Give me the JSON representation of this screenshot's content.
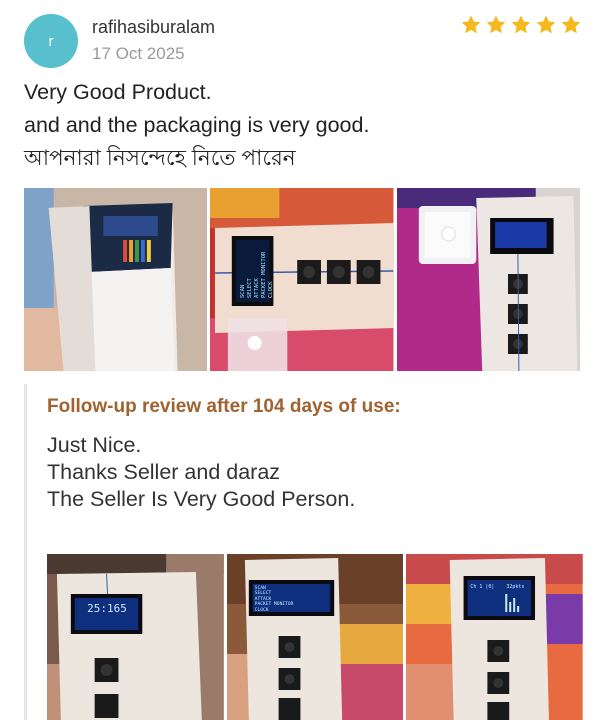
{
  "review": {
    "avatar_letter": "r",
    "username": "rafihasiburalam",
    "date": "17 Oct 2025",
    "rating": 5,
    "star_color": "#f5b91e",
    "text_lines": [
      "Very Good Product.",
      "and and the packaging is very good.",
      "আপনারা নিসন্দেহে নিতে পারেন"
    ],
    "photos": [
      "product-photo-1",
      "product-photo-2",
      "product-photo-3"
    ]
  },
  "followup": {
    "title": "Follow-up review after 104 days of use:",
    "text_lines": [
      "Just Nice.",
      "Thanks Seller and daraz",
      "The Seller Is Very Good Person."
    ],
    "photos": [
      "followup-photo-1",
      "followup-photo-2",
      "followup-photo-3"
    ]
  },
  "photo_text": {
    "oled_menu_lines": [
      "SCAN",
      "SELECT",
      "ATTACK",
      "PACKET MONITOR",
      "CLOCK"
    ],
    "oled_clock": "25:165",
    "oled_channel": "Ch 1 |0|",
    "oled_rate": "32pkts"
  }
}
